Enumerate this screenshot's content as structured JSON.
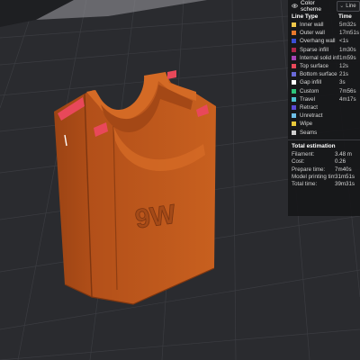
{
  "legend": {
    "scheme_label": "Color scheme",
    "scheme_select": "Line",
    "col_type": "Line Type",
    "col_time": "Time",
    "items": [
      {
        "name": "Inner wall",
        "time": "5m32s",
        "color": "#f0c84a"
      },
      {
        "name": "Outer wall",
        "time": "17m51s",
        "color": "#e8782c"
      },
      {
        "name": "Overhang wall",
        "time": "<1s",
        "color": "#3a4fd6"
      },
      {
        "name": "Sparse infill",
        "time": "1m30s",
        "color": "#b0284a"
      },
      {
        "name": "Internal solid infill",
        "time": "1m59s",
        "color": "#a845b8"
      },
      {
        "name": "Top surface",
        "time": "12s",
        "color": "#e8485a"
      },
      {
        "name": "Bottom surface",
        "time": "21s",
        "color": "#6a6ad8"
      },
      {
        "name": "Gap infill",
        "time": "3s",
        "color": "#ffffff"
      },
      {
        "name": "Custom",
        "time": "7m56s",
        "color": "#2ec47a"
      },
      {
        "name": "Travel",
        "time": "4m17s",
        "color": "#4ec0d0"
      },
      {
        "name": "Retract",
        "time": "",
        "color": "#5a4ad8"
      },
      {
        "name": "Unretract",
        "time": "",
        "color": "#6ec0e8"
      },
      {
        "name": "Wipe",
        "time": "",
        "color": "#e8c83a"
      },
      {
        "name": "Seams",
        "time": "",
        "color": "#cfcfcf"
      }
    ]
  },
  "estimation": {
    "title": "Total estimation",
    "rows": [
      {
        "key": "Filament:",
        "value": "3.48 m"
      },
      {
        "key": "Cost:",
        "value": "0.26"
      },
      {
        "key": "Prepare time:",
        "value": "7m40s"
      },
      {
        "key": "Model printing time:",
        "value": "31m51s"
      },
      {
        "key": "Total time:",
        "value": "39m31s"
      }
    ]
  },
  "model": {
    "embossed_text": "9W",
    "body_color": "#c65a1e",
    "accent_color": "#e8485a"
  },
  "colors": {
    "plate_bg": "#2a2b2f",
    "grid_line": "#3a3b40"
  }
}
